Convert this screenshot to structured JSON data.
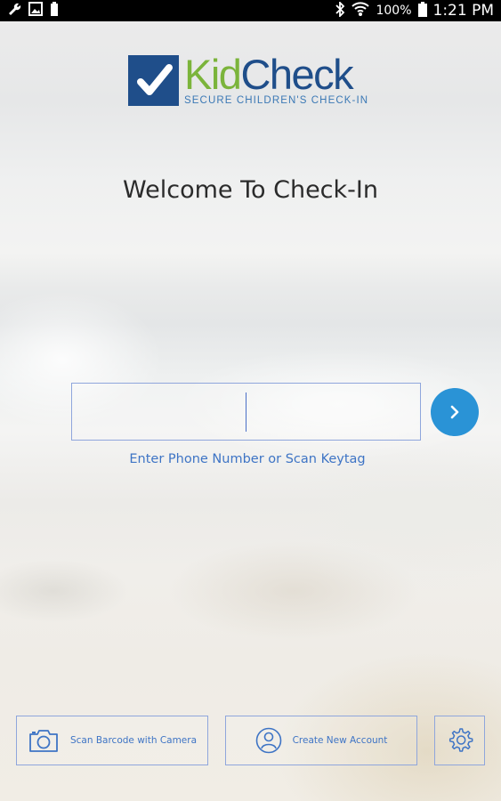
{
  "status_bar": {
    "icons_left": [
      "wrench-icon",
      "image-icon",
      "battery-small-icon"
    ],
    "icons_right": [
      "bluetooth-icon",
      "wifi-icon",
      "battery-icon"
    ],
    "battery": "100%",
    "time": "1:21 PM"
  },
  "logo": {
    "word_part1": "Kid",
    "word_part2": "Check",
    "tagline": "SECURE CHILDREN'S CHECK-IN",
    "colors": {
      "green": "#7bb43b",
      "navy": "#1f4e8a"
    }
  },
  "welcome_title": "Welcome To Check-In",
  "phone_input": {
    "value": "",
    "placeholder": ""
  },
  "hint": "Enter Phone Number or Scan Keytag",
  "buttons": {
    "scan": "Scan Barcode with Camera",
    "create": "Create New Account",
    "settings_icon": "gear-icon"
  },
  "accent_color": "#2a93d6"
}
